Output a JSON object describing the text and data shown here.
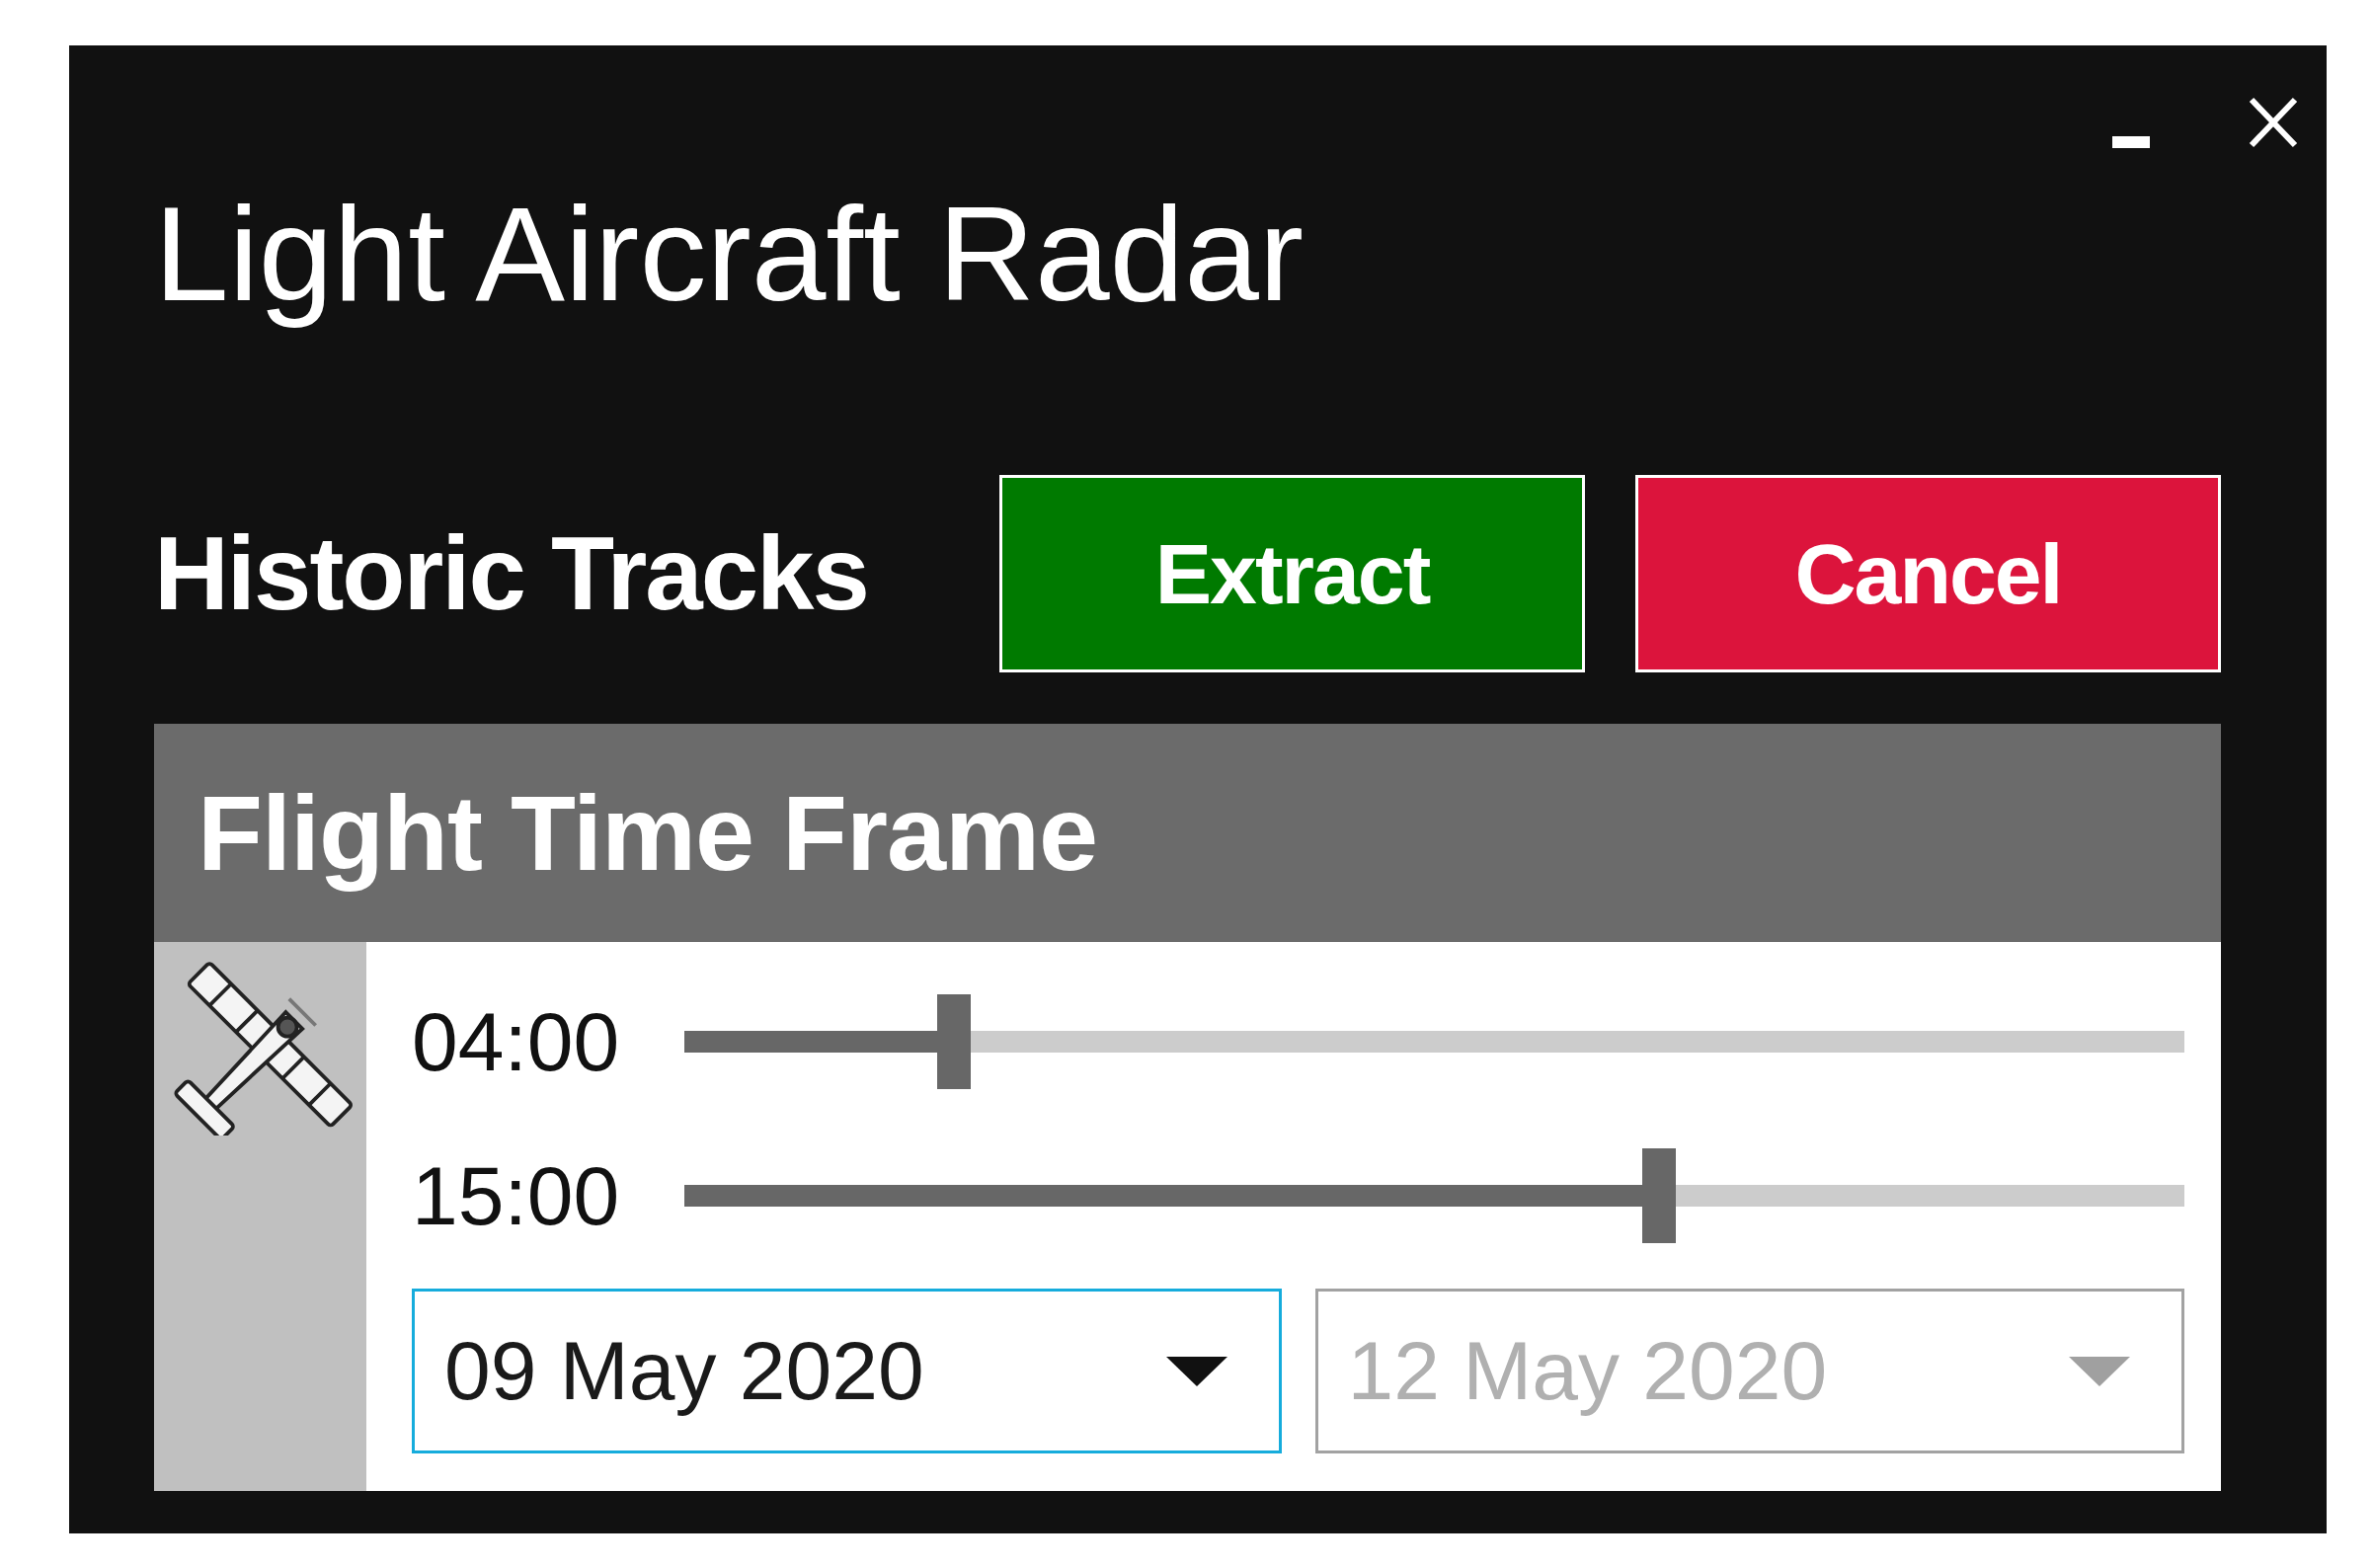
{
  "window": {
    "title": "Light Aircraft Radar"
  },
  "historic_tracks": {
    "label": "Historic Tracks",
    "buttons": [
      {
        "label": "Extract",
        "kind": "confirm"
      },
      {
        "label": "Cancel",
        "kind": "cancel"
      }
    ]
  },
  "flight_time_frame": {
    "title": "Flight Time Frame",
    "sliders": [
      {
        "reading": "04:00",
        "level": 0.18
      },
      {
        "reading": "15:00",
        "level": 0.65
      }
    ],
    "date_pickers": [
      {
        "value": "09 May 2020",
        "focused": true,
        "disabled": false
      },
      {
        "value": "12 May 2020",
        "focused": false,
        "disabled": true
      }
    ]
  }
}
